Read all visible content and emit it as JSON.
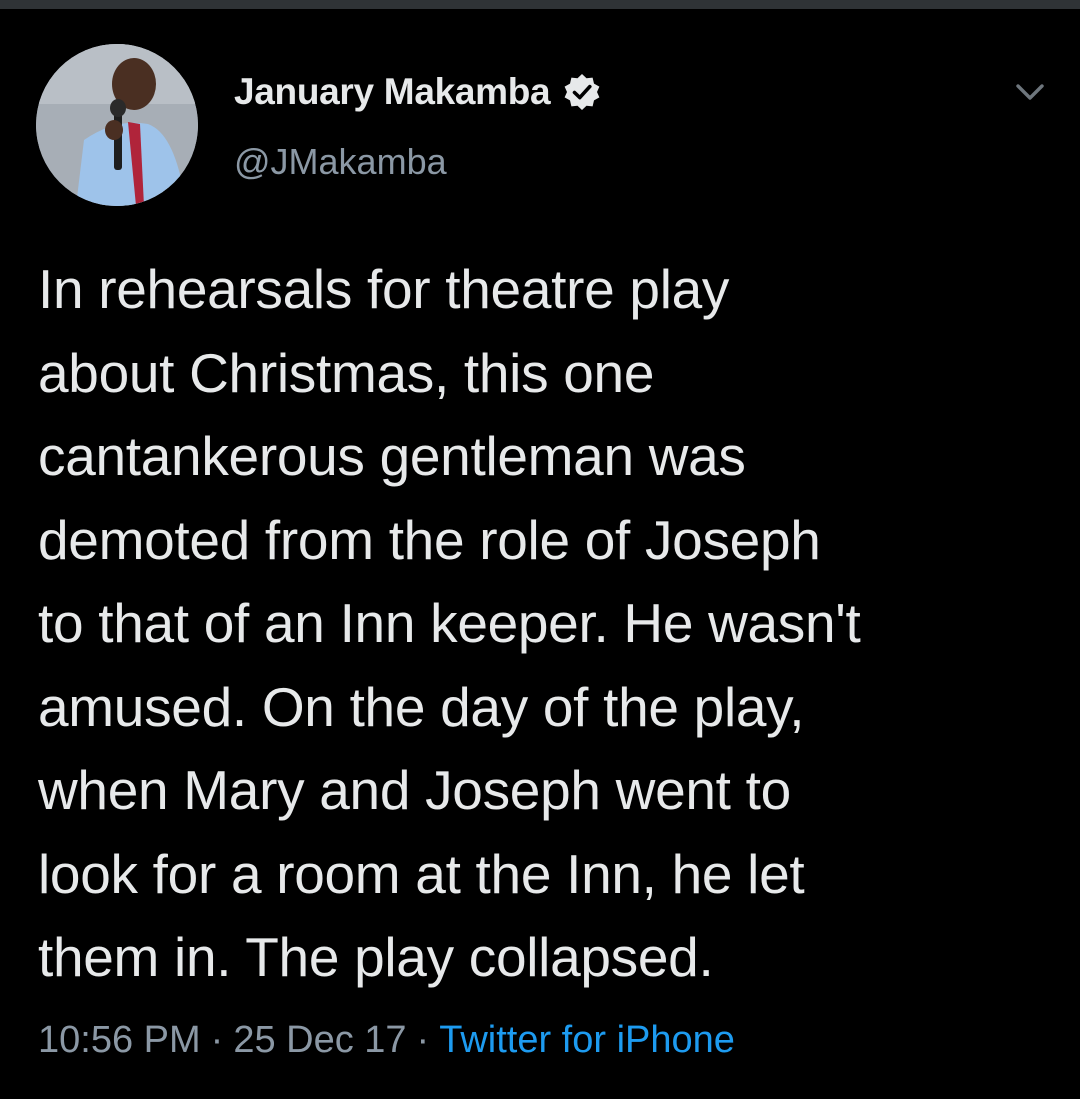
{
  "user": {
    "display_name": "January Makamba",
    "handle": "@JMakamba",
    "verified": true,
    "avatar": "profile-photo"
  },
  "tweet": {
    "text": "In rehearsals for theatre play\nabout Christmas, this one\ncantankerous gentleman was\ndemoted from the role of Joseph\nto that of an Inn keeper. He wasn't\namused. On the day of the play,\nwhen Mary and Joseph went to\nlook for a room at the Inn, he let\nthem in. The play collapsed."
  },
  "meta": {
    "time": "10:56 PM",
    "separator": "·",
    "date": "25 Dec 17",
    "source": "Twitter for iPhone"
  },
  "icons": {
    "verified": "verified-badge-icon",
    "more": "chevron-down-icon"
  },
  "colors": {
    "background": "#000000",
    "text": "#e7e9ea",
    "secondary": "#8b98a5",
    "link": "#1d9bf0"
  }
}
